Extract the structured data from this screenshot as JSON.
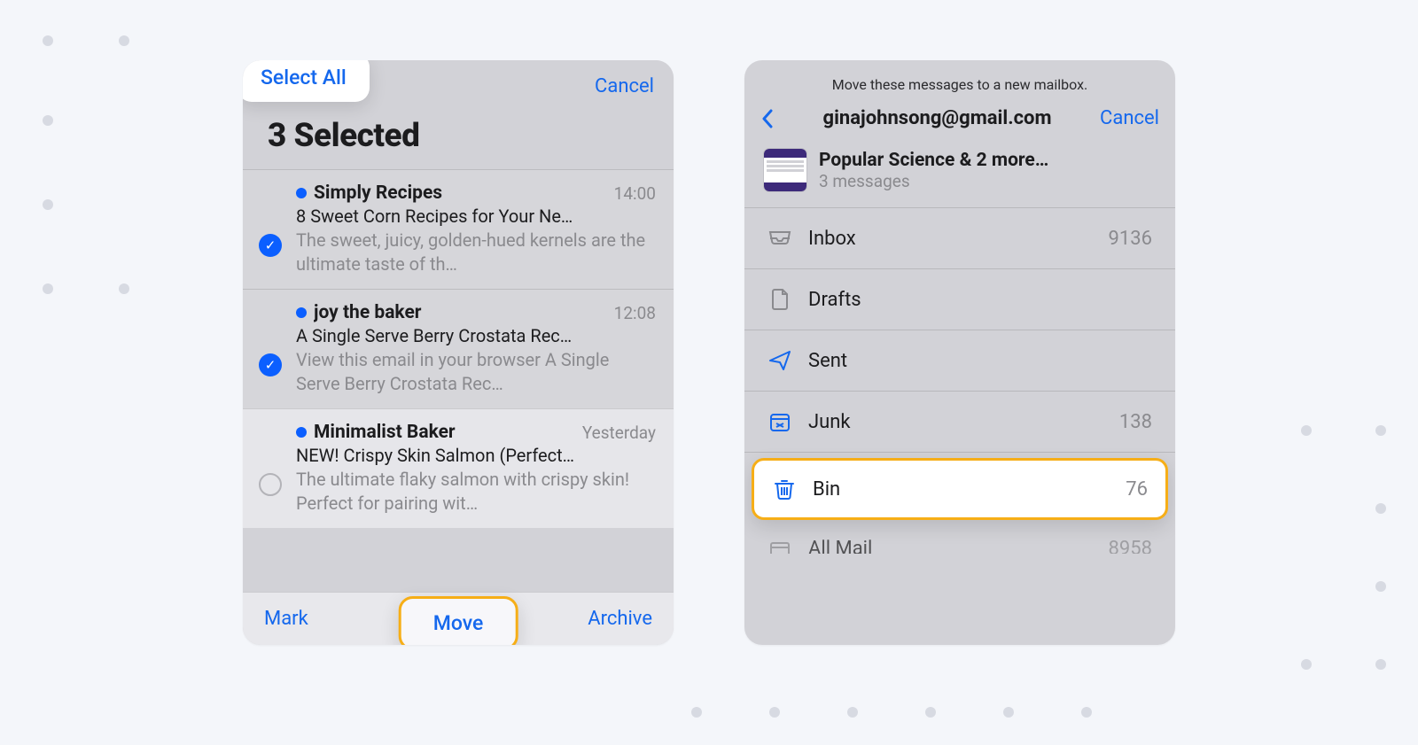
{
  "left": {
    "select_all": "Select All",
    "cancel": "Cancel",
    "title": "3 Selected",
    "toolbar": {
      "mark": "Mark",
      "move": "Move",
      "archive": "Archive"
    },
    "emails": [
      {
        "selected": true,
        "unread": true,
        "sender": "Simply Recipes",
        "time": "14:00",
        "subject": "8 Sweet Corn Recipes for Your Ne…",
        "preview": "The sweet, juicy, golden-hued kernels are the ultimate taste of th…"
      },
      {
        "selected": true,
        "unread": true,
        "sender": "joy the baker",
        "time": "12:08",
        "subject": "A Single Serve Berry Crostata Rec…",
        "preview": "View this email in your browser\nA Single Serve Berry Crostata Rec…"
      },
      {
        "selected": false,
        "unread": true,
        "sender": "Minimalist Baker",
        "time": "Yesterday",
        "subject": "NEW! Crispy Skin Salmon (Perfect…",
        "preview": "The ultimate flaky salmon with crispy skin! Perfect for pairing wit…"
      }
    ]
  },
  "right": {
    "hint": "Move these messages to a new mailbox.",
    "account": "ginajohnsong@gmail.com",
    "cancel": "Cancel",
    "summary": {
      "title": "Popular Science & 2 more…",
      "count": "3 messages"
    },
    "mailboxes": [
      {
        "icon": "inbox",
        "label": "Inbox",
        "count": "9136"
      },
      {
        "icon": "drafts",
        "label": "Drafts",
        "count": ""
      },
      {
        "icon": "sent",
        "label": "Sent",
        "count": ""
      },
      {
        "icon": "junk",
        "label": "Junk",
        "count": "138"
      },
      {
        "icon": "bin",
        "label": "Bin",
        "count": "76",
        "highlight": true
      },
      {
        "icon": "allmail",
        "label": "All Mail",
        "count": "8958",
        "cut": true
      }
    ]
  }
}
